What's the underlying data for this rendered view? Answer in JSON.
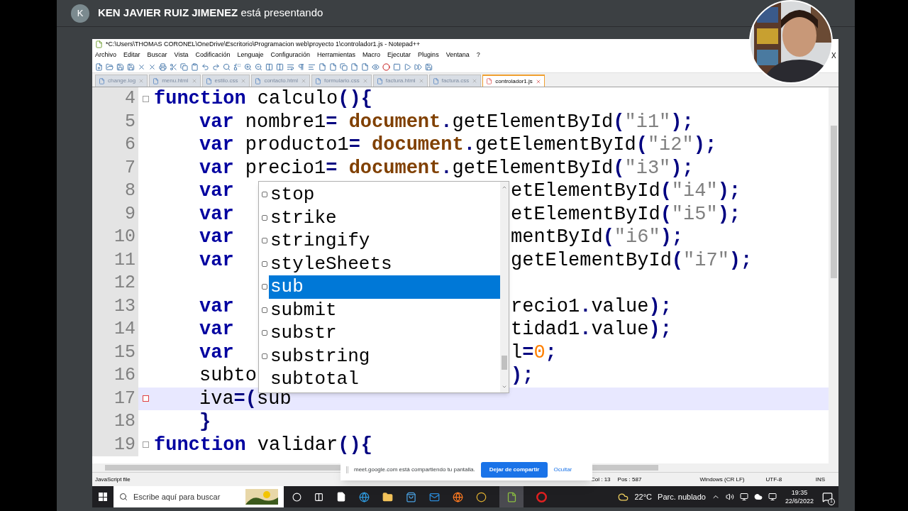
{
  "meet_banner": {
    "avatar_letter": "K",
    "presenter": "KEN JAVIER RUIZ JIMENEZ",
    "suffix": "está presentando"
  },
  "window": {
    "title": "*C:\\Users\\THOMAS CORONEL\\OneDrive\\Escritorio\\Programacion web\\proyecto 1\\controlador1.js - Notepad++",
    "close_glyph": "X"
  },
  "menu": [
    "Archivo",
    "Editar",
    "Buscar",
    "Vista",
    "Codificación",
    "Lenguaje",
    "Configuración",
    "Herramientas",
    "Macro",
    "Ejecutar",
    "Plugins",
    "Ventana",
    "?"
  ],
  "tabs": [
    {
      "label": "change.log",
      "selected": false
    },
    {
      "label": "menu.html",
      "selected": false
    },
    {
      "label": "estilo.css",
      "selected": false
    },
    {
      "label": "contacto.html",
      "selected": false
    },
    {
      "label": "formulario.css",
      "selected": false
    },
    {
      "label": "factura.html",
      "selected": false
    },
    {
      "label": "factura.css",
      "selected": false
    },
    {
      "label": "controlador1.js",
      "selected": true
    }
  ],
  "editor": {
    "lines": [
      {
        "number": "4",
        "fold_box": true,
        "current": false,
        "indented": false,
        "tokens": [
          {
            "kind": "kw",
            "text": "function"
          },
          {
            "kind": "plain",
            "text": " calculo"
          },
          {
            "kind": "op",
            "text": "(){"
          }
        ]
      },
      {
        "number": "5",
        "current": false,
        "indented": true,
        "tokens": [
          {
            "kind": "kw",
            "text": "var"
          },
          {
            "kind": "plain",
            "text": " nombre1"
          },
          {
            "kind": "op",
            "text": "="
          },
          {
            "kind": "obj",
            "text": " document"
          },
          {
            "kind": "op",
            "text": "."
          },
          {
            "kind": "plain",
            "text": "getElementById"
          },
          {
            "kind": "op",
            "text": "("
          },
          {
            "kind": "str",
            "text": "\"i1\""
          },
          {
            "kind": "op",
            "text": ");"
          }
        ]
      },
      {
        "number": "6",
        "current": false,
        "indented": true,
        "tokens": [
          {
            "kind": "kw",
            "text": "var"
          },
          {
            "kind": "plain",
            "text": " producto1"
          },
          {
            "kind": "op",
            "text": "="
          },
          {
            "kind": "obj",
            "text": " document"
          },
          {
            "kind": "op",
            "text": "."
          },
          {
            "kind": "plain",
            "text": "getElementById"
          },
          {
            "kind": "op",
            "text": "("
          },
          {
            "kind": "str",
            "text": "\"i2\""
          },
          {
            "kind": "op",
            "text": ");"
          }
        ]
      },
      {
        "number": "7",
        "current": false,
        "indented": true,
        "tokens": [
          {
            "kind": "kw",
            "text": "var"
          },
          {
            "kind": "plain",
            "text": " precio1"
          },
          {
            "kind": "op",
            "text": "="
          },
          {
            "kind": "obj",
            "text": " document"
          },
          {
            "kind": "op",
            "text": "."
          },
          {
            "kind": "plain",
            "text": "getElementById"
          },
          {
            "kind": "op",
            "text": "("
          },
          {
            "kind": "str",
            "text": "\"i3\""
          },
          {
            "kind": "op",
            "text": ");"
          }
        ]
      },
      {
        "number": "8",
        "current": false,
        "indented": true,
        "tokens": [
          {
            "kind": "kw",
            "text": "var"
          }
        ],
        "after_popup": [
          {
            "kind": "plain",
            "text": "etElementById"
          },
          {
            "kind": "op",
            "text": "("
          },
          {
            "kind": "str",
            "text": "\"i4\""
          },
          {
            "kind": "op",
            "text": ");"
          }
        ]
      },
      {
        "number": "9",
        "current": false,
        "indented": true,
        "tokens": [
          {
            "kind": "kw",
            "text": "var"
          }
        ],
        "after_popup": [
          {
            "kind": "plain",
            "text": "etElementById"
          },
          {
            "kind": "op",
            "text": "("
          },
          {
            "kind": "str",
            "text": "\"i5\""
          },
          {
            "kind": "op",
            "text": ");"
          }
        ]
      },
      {
        "number": "10",
        "current": false,
        "indented": true,
        "tokens": [
          {
            "kind": "kw",
            "text": "var"
          }
        ],
        "after_popup": [
          {
            "kind": "plain",
            "text": "mentById"
          },
          {
            "kind": "op",
            "text": "("
          },
          {
            "kind": "str",
            "text": "\"i6\""
          },
          {
            "kind": "op",
            "text": ");"
          }
        ]
      },
      {
        "number": "11",
        "current": false,
        "indented": true,
        "tokens": [
          {
            "kind": "kw",
            "text": "var"
          }
        ],
        "after_popup": [
          {
            "kind": "plain",
            "text": "getElementById"
          },
          {
            "kind": "op",
            "text": "("
          },
          {
            "kind": "str",
            "text": "\"i7\""
          },
          {
            "kind": "op",
            "text": ");"
          }
        ]
      },
      {
        "number": "12",
        "current": false
      },
      {
        "number": "13",
        "current": false,
        "indented": true,
        "tokens": [
          {
            "kind": "kw",
            "text": "var"
          }
        ],
        "after_popup": [
          {
            "kind": "plain",
            "text": "recio1"
          },
          {
            "kind": "op",
            "text": "."
          },
          {
            "kind": "plain",
            "text": "value"
          },
          {
            "kind": "op",
            "text": ");"
          }
        ]
      },
      {
        "number": "14",
        "current": false,
        "indented": true,
        "tokens": [
          {
            "kind": "kw",
            "text": "var"
          }
        ],
        "after_popup": [
          {
            "kind": "plain",
            "text": "tidad1"
          },
          {
            "kind": "op",
            "text": "."
          },
          {
            "kind": "plain",
            "text": "value"
          },
          {
            "kind": "op",
            "text": ");"
          }
        ]
      },
      {
        "number": "15",
        "current": false,
        "indented": true,
        "tokens": [
          {
            "kind": "kw",
            "text": "var"
          }
        ],
        "after_popup": [
          {
            "kind": "plain",
            "text": "l"
          },
          {
            "kind": "op",
            "text": "="
          },
          {
            "kind": "num",
            "text": "0"
          },
          {
            "kind": "op",
            "text": ";"
          }
        ]
      },
      {
        "number": "16",
        "current": false,
        "indented": true,
        "tokens": [
          {
            "kind": "plain",
            "text": "subto"
          }
        ],
        "after_popup": [
          {
            "kind": "op",
            "text": ");"
          }
        ]
      },
      {
        "number": "17",
        "change_mark": true,
        "current": true,
        "indented": true,
        "tokens": [
          {
            "kind": "plain",
            "text": "iva"
          },
          {
            "kind": "op",
            "text": "=("
          },
          {
            "kind": "plain",
            "text": "sub"
          }
        ]
      },
      {
        "number": "18",
        "current": false,
        "indented": true,
        "tokens": [
          {
            "kind": "op",
            "text": "}"
          }
        ]
      },
      {
        "number": "19",
        "fold_box": true,
        "current": false,
        "indented": false,
        "tokens": [
          {
            "kind": "kw",
            "text": "function"
          },
          {
            "kind": "plain",
            "text": " validar"
          },
          {
            "kind": "op",
            "text": "(){"
          }
        ]
      }
    ]
  },
  "autocomplete": [
    {
      "text": "stop",
      "icon": true,
      "selected": false
    },
    {
      "text": "strike",
      "icon": true,
      "selected": false
    },
    {
      "text": "stringify",
      "icon": true,
      "selected": false
    },
    {
      "text": "styleSheets",
      "icon": true,
      "selected": false
    },
    {
      "text": "sub",
      "icon": true,
      "selected": true
    },
    {
      "text": "submit",
      "icon": true,
      "selected": false
    },
    {
      "text": "substr",
      "icon": true,
      "selected": false
    },
    {
      "text": "substring",
      "icon": true,
      "selected": false
    },
    {
      "text": "subtotal",
      "icon": false,
      "selected": false
    }
  ],
  "status_bar": {
    "file_type": "JavaScript file",
    "col": "Col : 13",
    "pos": "Pos : 587",
    "eol": "Windows (CR LF)",
    "encoding": "UTF-8",
    "mode": "INS"
  },
  "share_notice": {
    "message": "meet.google.com está compartiendo tu pantalla.",
    "stop_button": "Dejar de compartir",
    "hide_link": "Ocultar"
  },
  "taskbar": {
    "search_placeholder": "Escribe aquí para buscar",
    "weather": "22°C",
    "weather_text": "Parc. nublado",
    "time": "19:35",
    "date": "22/6/2022",
    "notification_count": "1"
  }
}
